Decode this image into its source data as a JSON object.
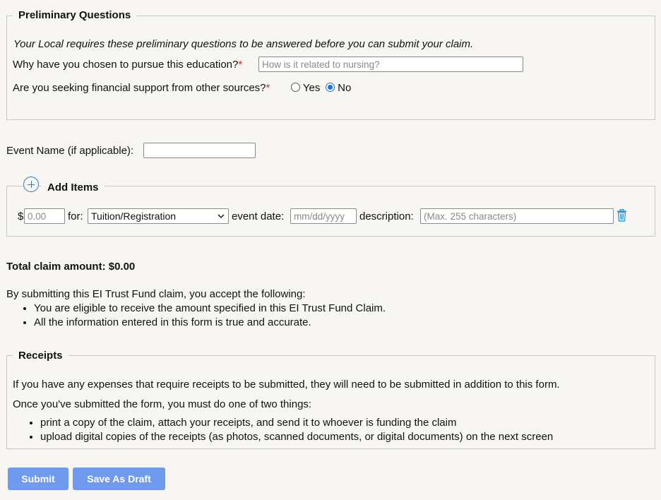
{
  "preliminary": {
    "legend": "Preliminary Questions",
    "intro": "Your Local requires these preliminary questions to be answered before you can submit your claim.",
    "why_label": "Why have you chosen to pursue this education?",
    "why_placeholder": "How is it related to nursing?",
    "required_mark": "*",
    "financial_label": "Are you seeking financial support from other sources?",
    "yes_label": "Yes",
    "no_label": "No",
    "financial_value": "No"
  },
  "event": {
    "label": "Event Name (if applicable):",
    "value": ""
  },
  "items": {
    "legend": "Add Items",
    "row": {
      "currency": "$",
      "amount_placeholder": "0.00",
      "for_label": "for:",
      "for_selected": "Tuition/Registration",
      "date_label": "event date:",
      "date_placeholder": "mm/dd/yyyy",
      "desc_label": "description:",
      "desc_placeholder": "(Max. 255 characters)"
    }
  },
  "total": {
    "text": "Total claim amount: $0.00"
  },
  "terms": {
    "intro": "By submitting this EI Trust Fund claim, you accept the following:",
    "items": [
      "You are eligible to receive the amount specified in this EI Trust Fund Claim.",
      "All the information entered in this form is true and accurate."
    ]
  },
  "receipts": {
    "legend": "Receipts",
    "para1": "If you have any expenses that require receipts to be submitted, they will need to be submitted in addition to this form.",
    "para2": "Once you've submitted the form, you must do one of two things:",
    "items": [
      "print a copy of the claim, attach your receipts, and send it to whoever is funding the claim",
      "upload digital copies of the receipts (as photos, scanned documents, or digital documents) on the next screen"
    ]
  },
  "buttons": {
    "submit": "Submit",
    "save_draft": "Save As Draft"
  },
  "colors": {
    "accent": "#1a73e8",
    "button": "#6f9af0",
    "plus_icon": "#2a7ab8",
    "required": "#dd2222"
  }
}
